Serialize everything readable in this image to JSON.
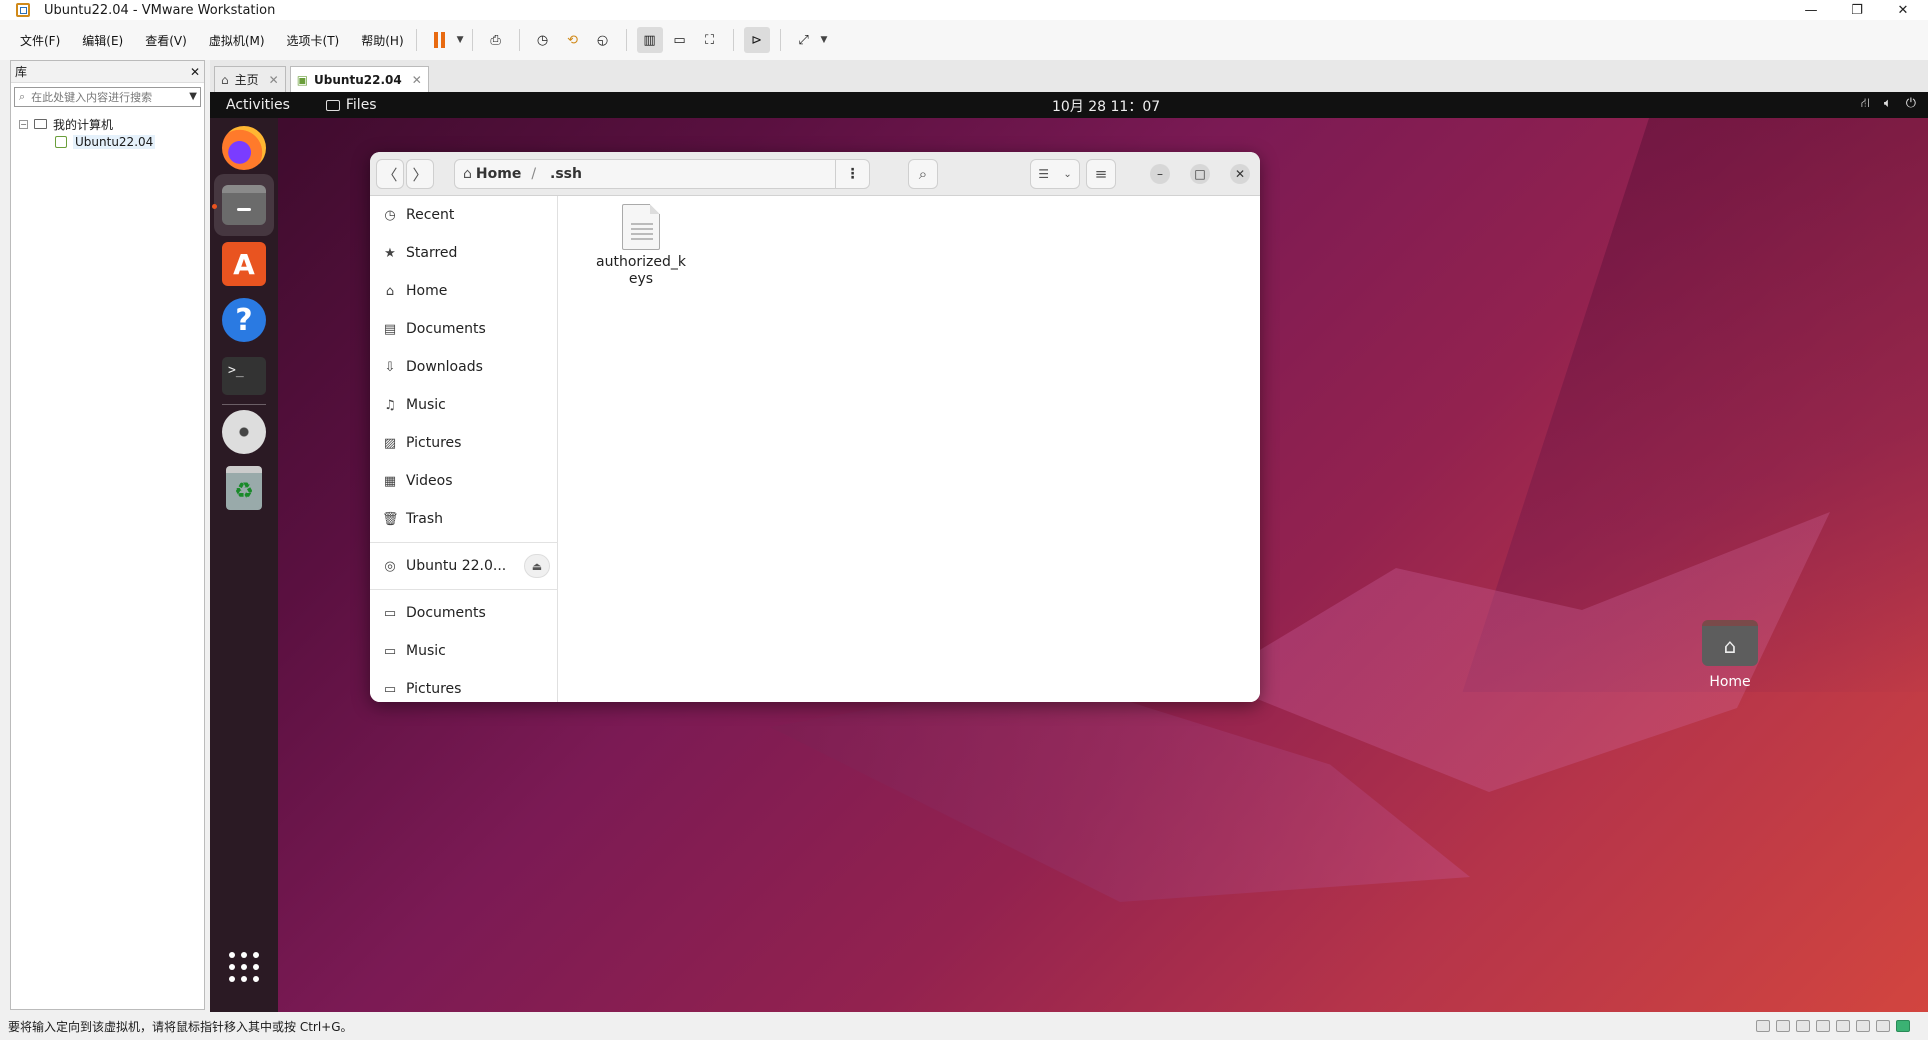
{
  "window": {
    "title": "Ubuntu22.04 - VMware Workstation",
    "controls": {
      "minimize": "—",
      "restore": "❐",
      "close": "✕"
    }
  },
  "menu": [
    "文件(F)",
    "编辑(E)",
    "查看(V)",
    "虚拟机(M)",
    "选项卡(T)",
    "帮助(H)"
  ],
  "library": {
    "title": "库",
    "close": "✕",
    "search_placeholder": "在此处键入内容进行搜索",
    "tree": {
      "root": "我的计算机",
      "vm": "Ubuntu22.04"
    }
  },
  "tabs": [
    {
      "label": "主页",
      "close": "✕"
    },
    {
      "label": "Ubuntu22.04",
      "close": "✕",
      "active": true
    }
  ],
  "guest": {
    "topbar": {
      "activities": "Activities",
      "app": "Files",
      "clock": "10月 28 11：07"
    },
    "desktop_icon": "Home",
    "files": {
      "path": [
        "Home",
        ".ssh"
      ],
      "sidebar": [
        "Recent",
        "Starred",
        "Home",
        "Documents",
        "Downloads",
        "Music",
        "Pictures",
        "Videos",
        "Trash"
      ],
      "device": "Ubuntu 22.0...",
      "bookmarks": [
        "Documents",
        "Music",
        "Pictures"
      ],
      "items": [
        {
          "name": "authorized_keys"
        }
      ]
    }
  },
  "statusbar": {
    "message": "要将输入定向到该虚拟机，请将鼠标指针移入其中或按 Ctrl+G。"
  },
  "colors": {
    "ubuntu_orange": "#e95420",
    "pause": "#e86a10",
    "topbar": "#111111",
    "dock": "#2b1a24"
  }
}
